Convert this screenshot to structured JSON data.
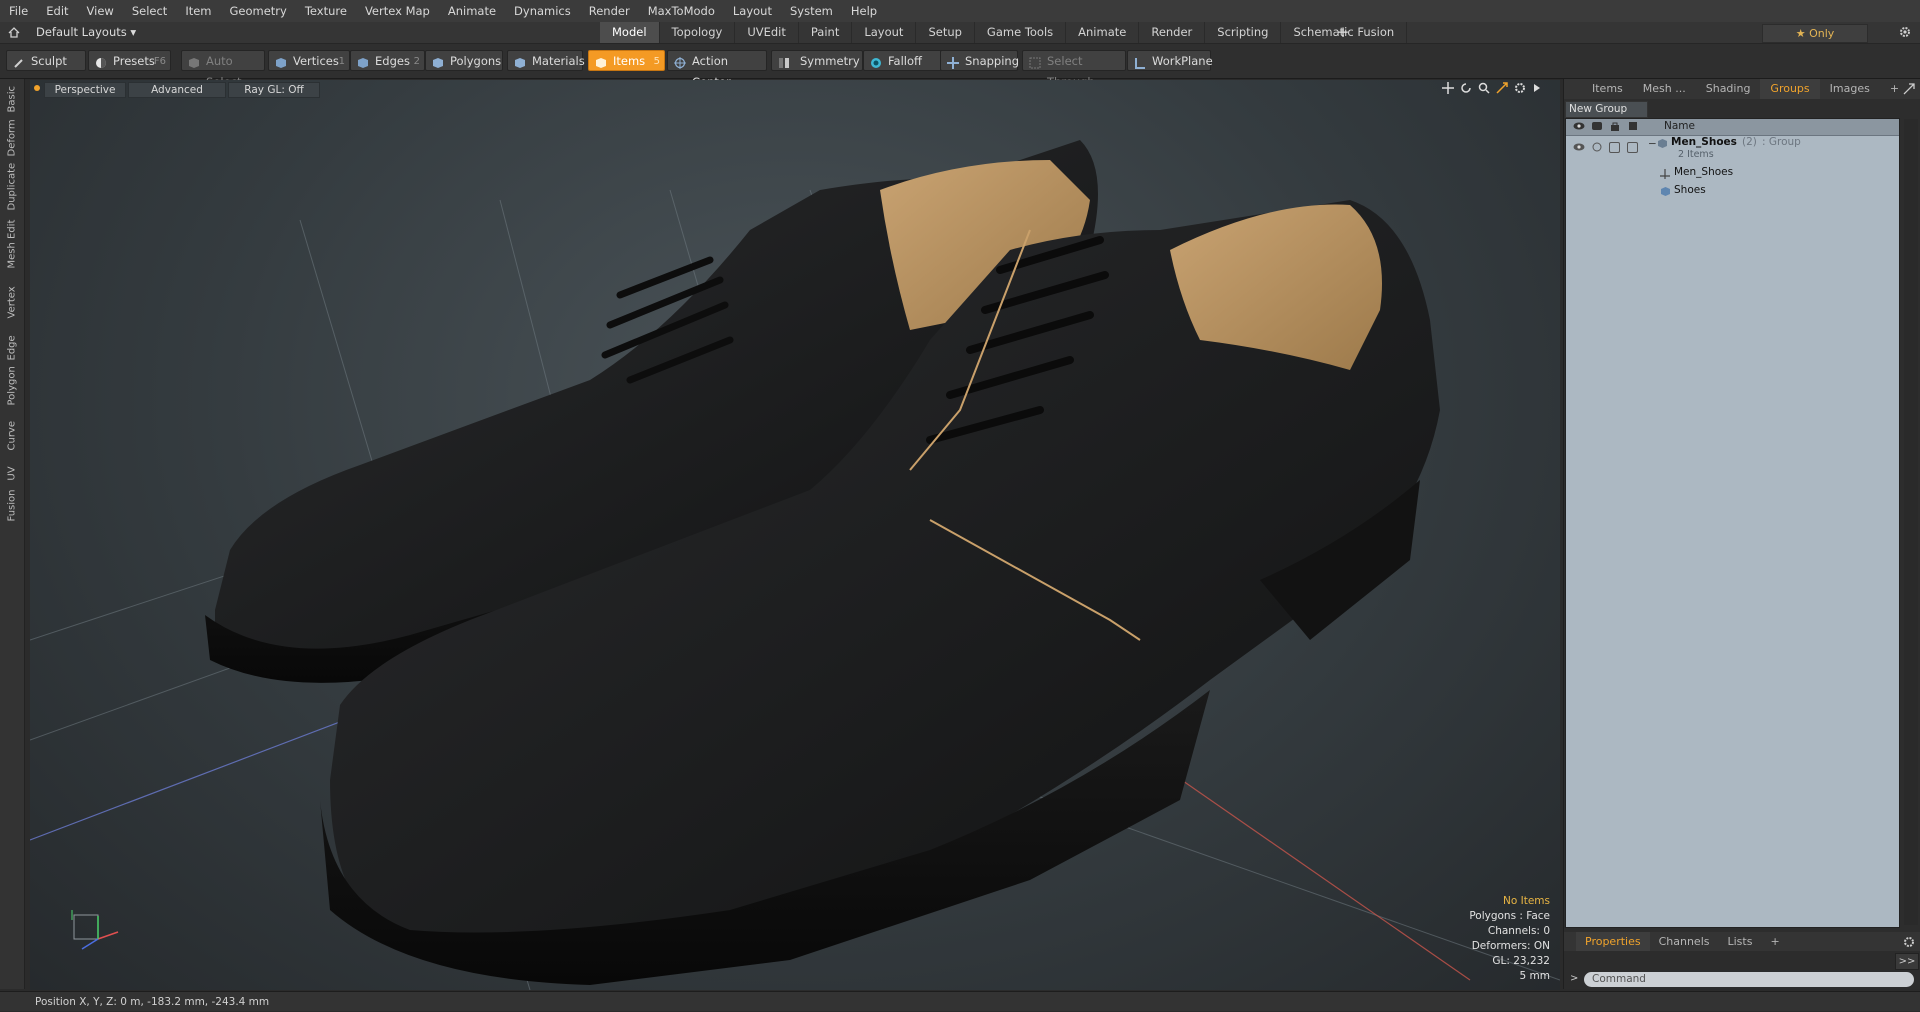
{
  "menu": [
    "File",
    "Edit",
    "View",
    "Select",
    "Item",
    "Geometry",
    "Texture",
    "Vertex Map",
    "Animate",
    "Dynamics",
    "Render",
    "MaxToModo",
    "Layout",
    "System",
    "Help"
  ],
  "layout": {
    "label": "Default Layouts ▾"
  },
  "tabs": [
    {
      "label": "Model",
      "active": true
    },
    {
      "label": "Topology"
    },
    {
      "label": "UVEdit"
    },
    {
      "label": "Paint"
    },
    {
      "label": "Layout"
    },
    {
      "label": "Setup"
    },
    {
      "label": "Game Tools"
    },
    {
      "label": "Animate"
    },
    {
      "label": "Render"
    },
    {
      "label": "Scripting"
    },
    {
      "label": "Schematic Fusion"
    }
  ],
  "add_tab": "+",
  "only": "★ Only",
  "toolbar": {
    "sculpt": "Sculpt",
    "presets": "Presets",
    "presets_key": "F6",
    "auto_select": "Auto Select",
    "vertices": "Vertices",
    "vertices_key": "1",
    "edges": "Edges",
    "edges_key": "2",
    "polygons": "Polygons",
    "materials": "Materials",
    "items": "Items",
    "items_key": "5",
    "action_center": "Action Center",
    "symmetry": "Symmetry",
    "falloff": "Falloff",
    "snapping": "Snapping",
    "select_through": "Select Through",
    "workplane": "WorkPlane"
  },
  "left_tabs": [
    "Basic",
    "Deform",
    "Duplicate",
    "Mesh Edit",
    "Vertex",
    "Edge",
    "Polygon",
    "Curve",
    "UV",
    "Fusion"
  ],
  "viewport": {
    "perspective": "Perspective",
    "advanced": "Advanced",
    "raygl": "Ray GL: Off",
    "info": {
      "no_items": "No Items",
      "polygons": "Polygons : Face",
      "channels": "Channels: 0",
      "deformers": "Deformers: ON",
      "gl": "GL: 23,232",
      "unit": "5 mm"
    }
  },
  "right_panel": {
    "tabs": [
      {
        "label": "Items"
      },
      {
        "label": "Mesh ..."
      },
      {
        "label": "Shading"
      },
      {
        "label": "Groups",
        "active": true
      },
      {
        "label": "Images"
      }
    ],
    "add": "+",
    "new_group": "New Group",
    "column_name": "Name",
    "group": {
      "name": "Men_Shoes",
      "count": "(2)",
      "type": ": Group",
      "sub": "2 Items"
    },
    "children": [
      {
        "label": "Men_Shoes",
        "icon": "locator-icon"
      },
      {
        "label": "Shoes",
        "icon": "mesh-icon"
      }
    ]
  },
  "properties": {
    "tabs": [
      {
        "label": "Properties",
        "active": true
      },
      {
        "label": "Channels"
      },
      {
        "label": "Lists"
      }
    ],
    "add": "+",
    "expand": ">>",
    "command": "Command"
  },
  "status": {
    "position": "Position X, Y, Z:  0 m, -183.2 mm, -243.4 mm"
  },
  "colors": {
    "accent": "#f49a24",
    "shoe": "#1f1f1f",
    "lining": "#c9a06a"
  }
}
